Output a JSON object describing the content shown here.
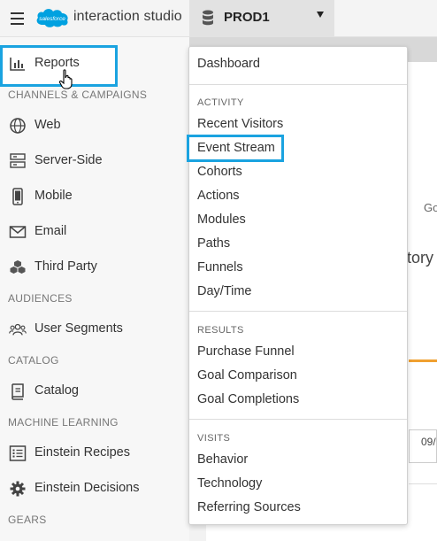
{
  "header": {
    "logo_word": "salesforce",
    "product_name": "interaction studio",
    "environment": "PROD1",
    "menu_icon": "hamburger-icon"
  },
  "colors": {
    "highlight": "#1aa3e0",
    "salesforce_blue": "#00a1e0",
    "accent_orange": "#f0a030"
  },
  "sidebar": {
    "reports_label": "Reports",
    "sections": {
      "channels": "CHANNELS & CAMPAIGNS",
      "audiences": "AUDIENCES",
      "catalog": "CATALOG",
      "ml": "MACHINE LEARNING",
      "gears": "GEARS"
    },
    "items": {
      "web": "Web",
      "server_side": "Server-Side",
      "mobile": "Mobile",
      "email": "Email",
      "third_party": "Third Party",
      "user_segments": "User Segments",
      "catalog": "Catalog",
      "einstein_recipes": "Einstein Recipes",
      "einstein_decisions": "Einstein Decisions"
    }
  },
  "background": {
    "go_text": "Go",
    "tory_text": "tory",
    "date_text": "09/"
  },
  "dropdown": {
    "dashboard": "Dashboard",
    "activity_header": "ACTIVITY",
    "activity": [
      "Recent Visitors",
      "Event Stream",
      "Cohorts",
      "Actions",
      "Modules",
      "Paths",
      "Funnels",
      "Day/Time"
    ],
    "results_header": "RESULTS",
    "results": [
      "Purchase Funnel",
      "Goal Comparison",
      "Goal Completions"
    ],
    "visits_header": "VISITS",
    "visits": [
      "Behavior",
      "Technology",
      "Referring Sources"
    ]
  }
}
